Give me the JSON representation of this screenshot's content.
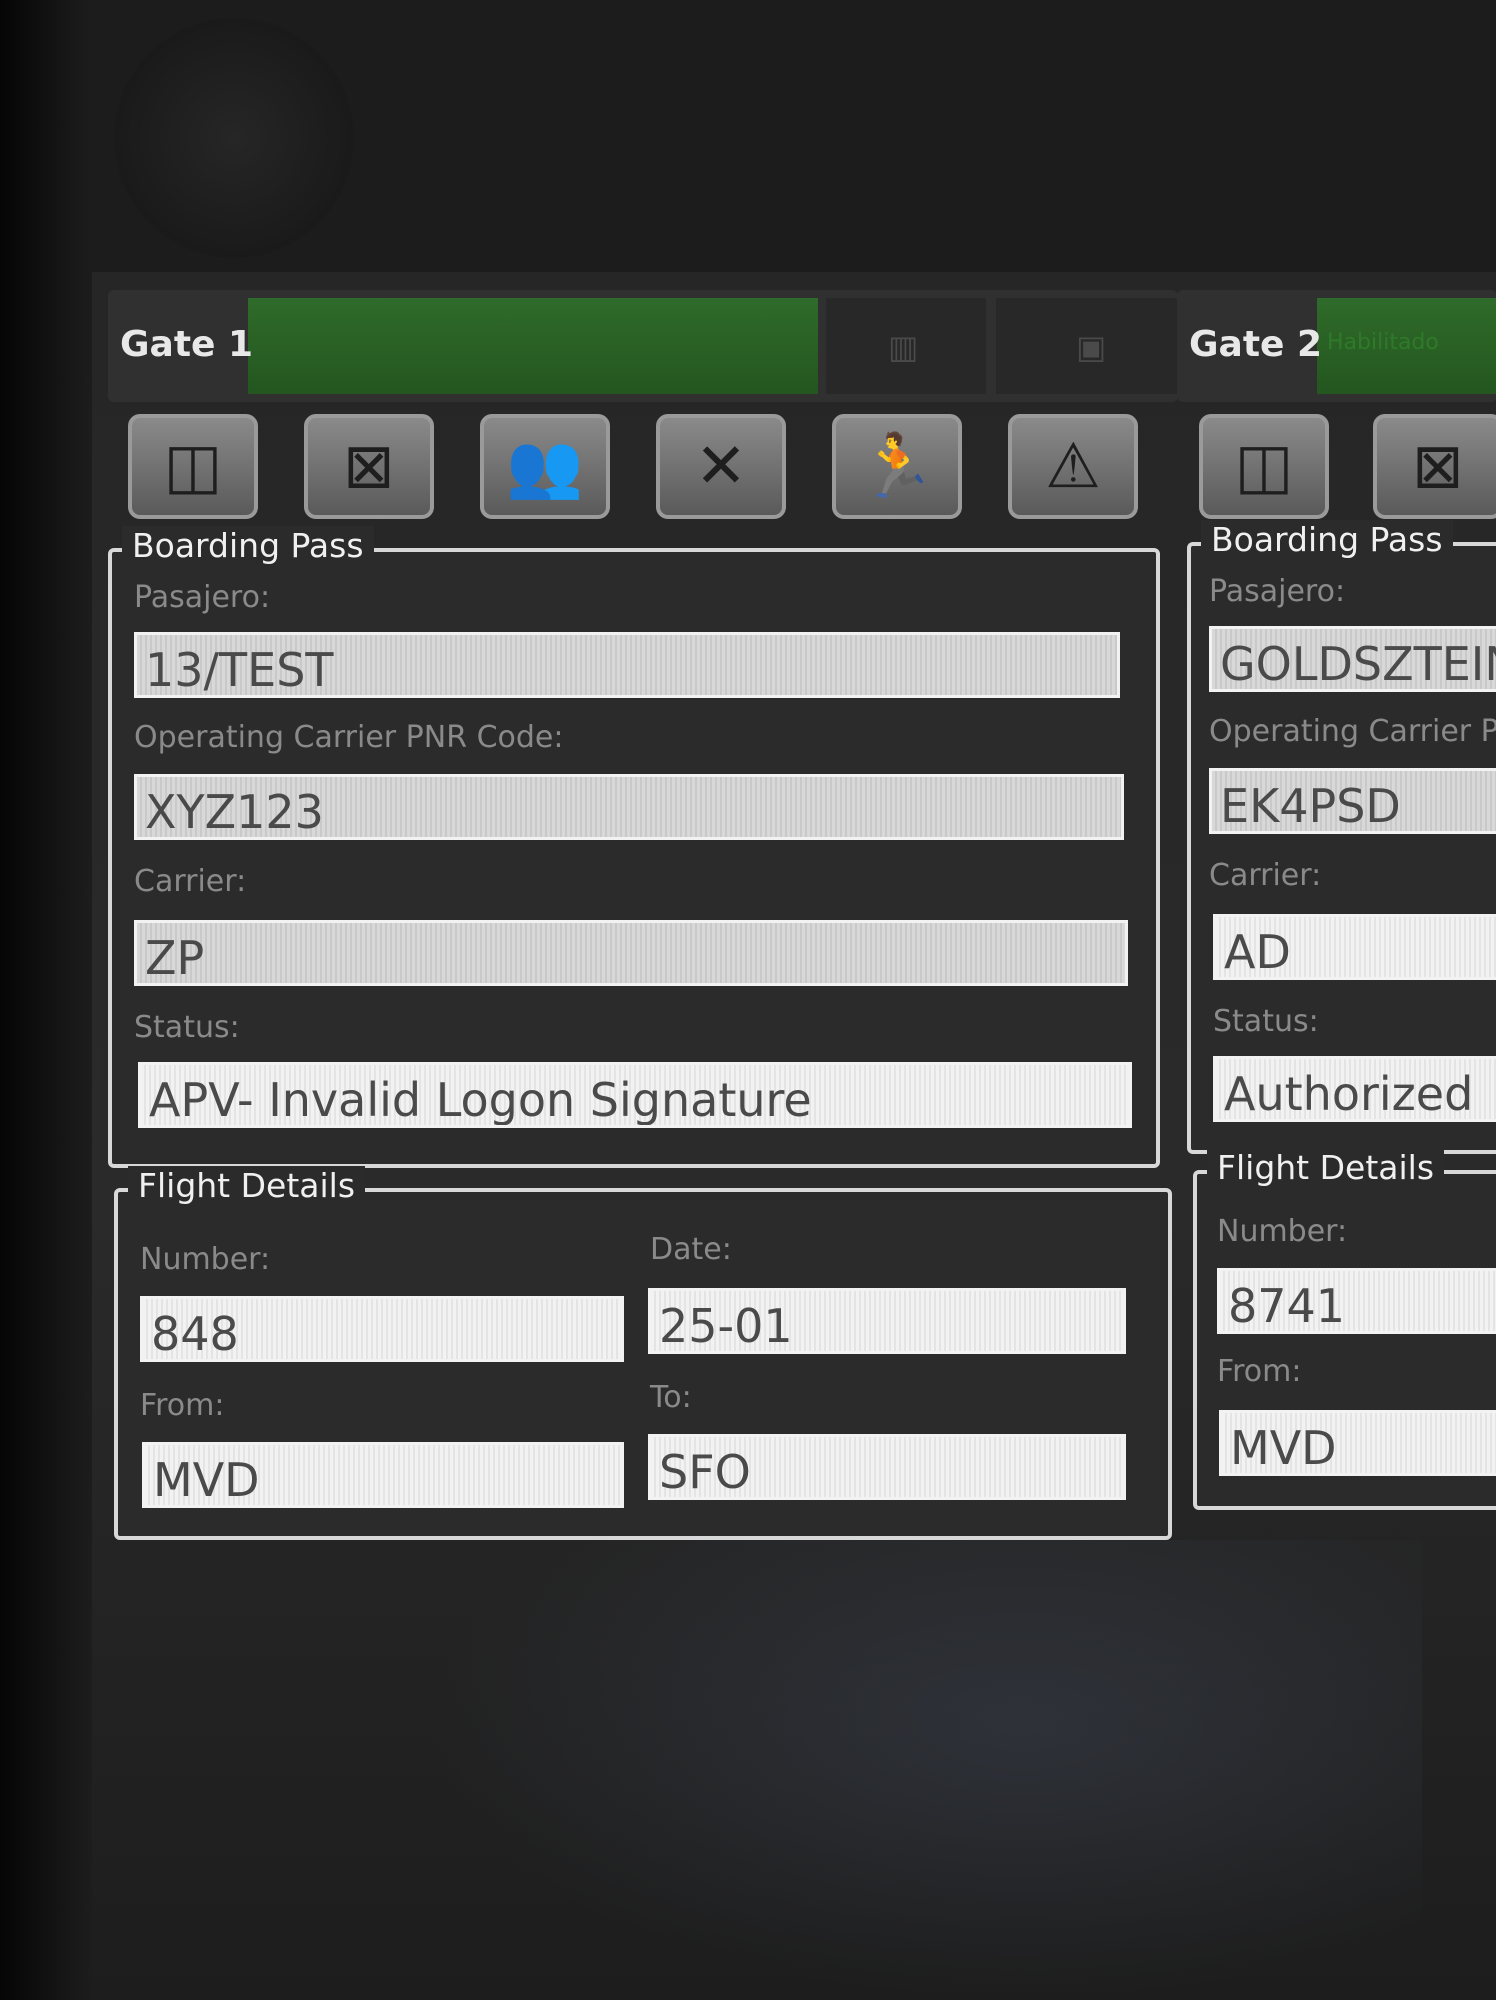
{
  "gates": [
    {
      "title": "Gate 1",
      "boarding_pass": {
        "heading": "Boarding Pass",
        "passenger_label": "Pasajero:",
        "passenger": "13/TEST",
        "pnr_label": "Operating Carrier PNR Code:",
        "pnr": "XYZ123",
        "carrier_label": "Carrier:",
        "carrier": "ZP",
        "status_label": "Status:",
        "status": "APV- Invalid Logon Signature"
      },
      "flight_details": {
        "heading": "Flight Details",
        "number_label": "Number:",
        "number": "848",
        "date_label": "Date:",
        "date": "25-01",
        "from_label": "From:",
        "from": "MVD",
        "to_label": "To:",
        "to": "SFO"
      }
    },
    {
      "title": "Gate 2",
      "status_text": "Habilitado",
      "boarding_pass": {
        "heading": "Boarding Pass",
        "passenger_label": "Pasajero:",
        "passenger": "GOLDSZTEIN",
        "pnr_label": "Operating Carrier PI",
        "pnr": "EK4PSD",
        "carrier_label": "Carrier:",
        "carrier": "AD",
        "status_label": "Status:",
        "status": "Authorized"
      },
      "flight_details": {
        "heading": "Flight Details",
        "number_label": "Number:",
        "number": "8741",
        "from_label": "From:",
        "from": "MVD"
      }
    }
  ],
  "icons": {
    "gate1": [
      "door-icon",
      "turnstile-icon",
      "two-persons-icon",
      "person-blocked-icon",
      "person-running-icon",
      "warning-arrows-icon"
    ],
    "gate2": [
      "door-icon",
      "turnstile-icon"
    ]
  }
}
